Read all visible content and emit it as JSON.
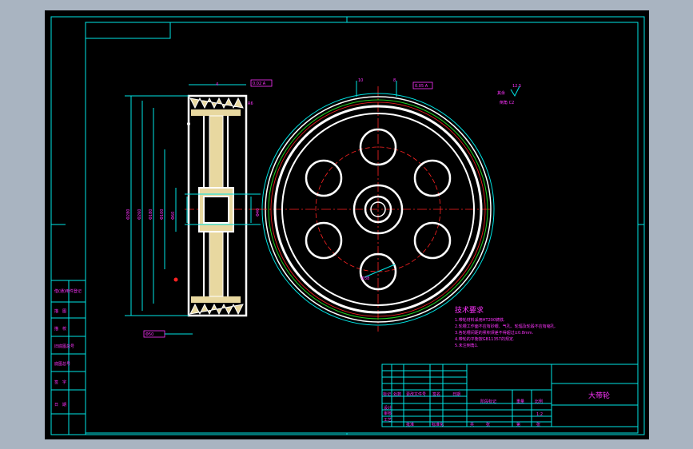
{
  "drawing": {
    "title": "大带轮",
    "technical_requirements": {
      "heading": "技术要求",
      "items": [
        "1.带轮材料采用HT200铸铁.",
        "2.轮槽工作面不应有砂眼、气孔、轮辐及轮毂不应有缩孔.",
        "3.各轮槽间距的累积误差不得超过±0.8mm.",
        "4.带轮的平衡按GB11357的规定.",
        "5.未注倒角1."
      ]
    },
    "roughness_note": {
      "value": "12.5",
      "label": "其余",
      "finish": "倒角 C2"
    },
    "left_stamp": [
      "借(通)用件登记",
      "描　图",
      "描　校",
      "旧底图总号",
      "底图总号",
      "签　字",
      "日　期"
    ],
    "title_block": {
      "cells": [
        "标记",
        "处数",
        "更改文件号",
        "签名",
        "日期",
        "设计",
        "审核",
        "工艺",
        "批准",
        "阶段标记",
        "重量",
        "比例",
        "共",
        "张",
        "第",
        "张",
        "1:2",
        "标准化"
      ]
    },
    "dimensions": [
      "Φ280",
      "Φ260",
      "Φ180",
      "Φ100",
      "Φ60",
      "Φ40",
      "Φ50",
      "Φ38",
      "0.02 A",
      "0.05 A",
      "10",
      "8",
      "4",
      "R6"
    ]
  },
  "colors": {
    "frame": "#00e6e6",
    "text": "#ff33ff",
    "outline": "#ffffff",
    "center": "#ff2222",
    "pitch": "#22cc22",
    "background": "#000000",
    "window": "#a9b4c1"
  }
}
